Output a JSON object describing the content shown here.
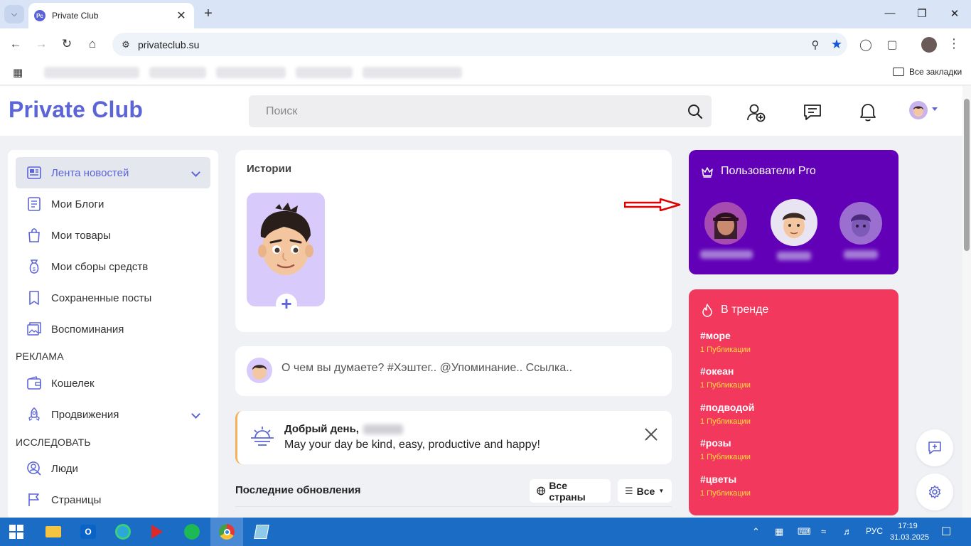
{
  "browser": {
    "tab_title": "Private Club",
    "favicon_text": "Pc",
    "url": "privateclub.su",
    "bookmarks_all_label": "Все закладки"
  },
  "site": {
    "logo": "Private Club",
    "search_placeholder": "Поиск",
    "accent_color": "#5b64d9"
  },
  "sidebar": {
    "items": [
      {
        "label": "Лента новостей",
        "icon": "newspaper-icon",
        "active": true
      },
      {
        "label": "Мои Блоги",
        "icon": "blog-icon"
      },
      {
        "label": "Мои товары",
        "icon": "shopping-bag-icon"
      },
      {
        "label": "Мои сборы средств",
        "icon": "fundraising-icon"
      },
      {
        "label": "Сохраненные посты",
        "icon": "bookmark-icon"
      },
      {
        "label": "Воспоминания",
        "icon": "memories-icon"
      }
    ],
    "section_ads": "РЕКЛАМА",
    "ads_items": [
      {
        "label": "Кошелек",
        "icon": "wallet-icon"
      },
      {
        "label": "Продвижения",
        "icon": "rocket-icon"
      }
    ],
    "section_explore": "ИССЛЕДОВАТЬ",
    "explore_items": [
      {
        "label": "Люди",
        "icon": "people-icon"
      },
      {
        "label": "Страницы",
        "icon": "flag-icon"
      }
    ]
  },
  "stories": {
    "title": "Истории"
  },
  "composer": {
    "placeholder": "О чем вы думаете? #Хэштег.. @Упоминание.. Ссылка.."
  },
  "greeting": {
    "title": "Добрый день,",
    "message": "May your day be kind, easy, productive and happy!"
  },
  "updates": {
    "title": "Последние обновления",
    "countries_button": "Все страны",
    "filter_button": "Все"
  },
  "pro_users": {
    "title": "Пользователи Pro",
    "color": "#6200b8"
  },
  "trending": {
    "title": "В тренде",
    "color": "#f3385d",
    "tags": [
      {
        "tag": "#море",
        "count": "1 Публикации"
      },
      {
        "tag": "#океан",
        "count": "1 Публикации"
      },
      {
        "tag": "#подводой",
        "count": "1 Публикации"
      },
      {
        "tag": "#розы",
        "count": "1 Публикации"
      },
      {
        "tag": "#цветы",
        "count": "1 Публикации"
      }
    ]
  },
  "taskbar": {
    "language": "РУС",
    "time": "17:19",
    "date": "31.03.2025"
  }
}
